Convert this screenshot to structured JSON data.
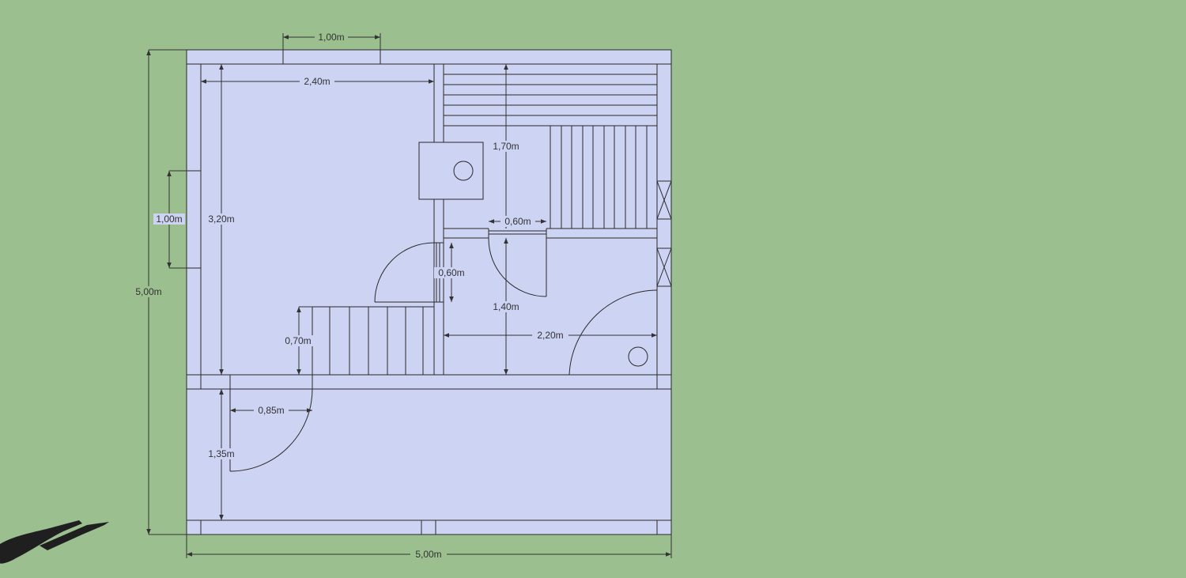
{
  "colors": {
    "background": "#9bbf8f",
    "floor": "#cdd3f3",
    "line": "#2a2a2a",
    "dimension": "#333333"
  },
  "dimensions": {
    "top_window": "1,00m",
    "left_room_width": "2,40m",
    "left_room_height": "3,20m",
    "left_window": "1,00m",
    "total_height": "5,00m",
    "total_width": "5,00m",
    "sauna_height": "1,70m",
    "sauna_door": "0,60m",
    "bath_door": "0,60m",
    "washroom_height": "1,40m",
    "washroom_width": "2,20m",
    "bench_depth": "0,70m",
    "entry_door": "0,85m",
    "porch_depth": "1,35m"
  },
  "icons": {
    "stove": "stove-icon",
    "drain": "drain-icon",
    "person": "person-shadow-icon"
  }
}
